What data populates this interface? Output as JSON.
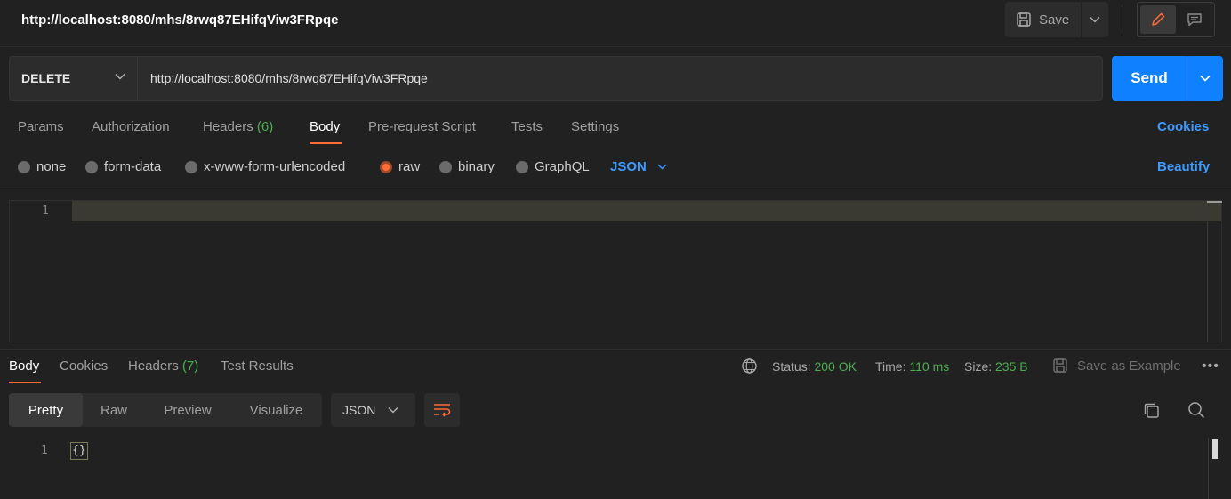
{
  "header": {
    "title": "http://localhost:8080/mhs/8rwq87EHifqViw3FRpqe",
    "save_label": "Save"
  },
  "request": {
    "method": "DELETE",
    "url": "http://localhost:8080/mhs/8rwq87EHifqViw3FRpqe",
    "send_label": "Send"
  },
  "request_tabs": {
    "params": "Params",
    "authorization": "Authorization",
    "headers": "Headers",
    "headers_count": "(6)",
    "body": "Body",
    "pre_request": "Pre-request Script",
    "tests": "Tests",
    "settings": "Settings",
    "active": "Body",
    "cookies": "Cookies"
  },
  "body_types": {
    "none": "none",
    "form_data": "form-data",
    "urlencoded": "x-www-form-urlencoded",
    "raw": "raw",
    "binary": "binary",
    "graphql": "GraphQL",
    "selected": "raw",
    "raw_format": "JSON",
    "beautify": "Beautify"
  },
  "editor": {
    "line_number": "1",
    "content": ""
  },
  "response_tabs": {
    "body": "Body",
    "cookies": "Cookies",
    "headers": "Headers",
    "headers_count": "(7)",
    "test_results": "Test Results",
    "active": "Body"
  },
  "response_meta": {
    "status_label": "Status:",
    "status_value": "200 OK",
    "time_label": "Time:",
    "time_value": "110 ms",
    "size_label": "Size:",
    "size_value": "235 B",
    "save_example": "Save as Example",
    "more": "•••"
  },
  "response_view": {
    "pretty": "Pretty",
    "raw": "Raw",
    "preview": "Preview",
    "visualize": "Visualize",
    "active": "Pretty",
    "format": "JSON"
  },
  "response_body": {
    "line_number": "1",
    "content": "{}"
  },
  "colors": {
    "accent": "#ff6c37",
    "send": "#0f80ff",
    "link": "#3d9bff",
    "success": "#4caf50",
    "background": "#212121"
  }
}
